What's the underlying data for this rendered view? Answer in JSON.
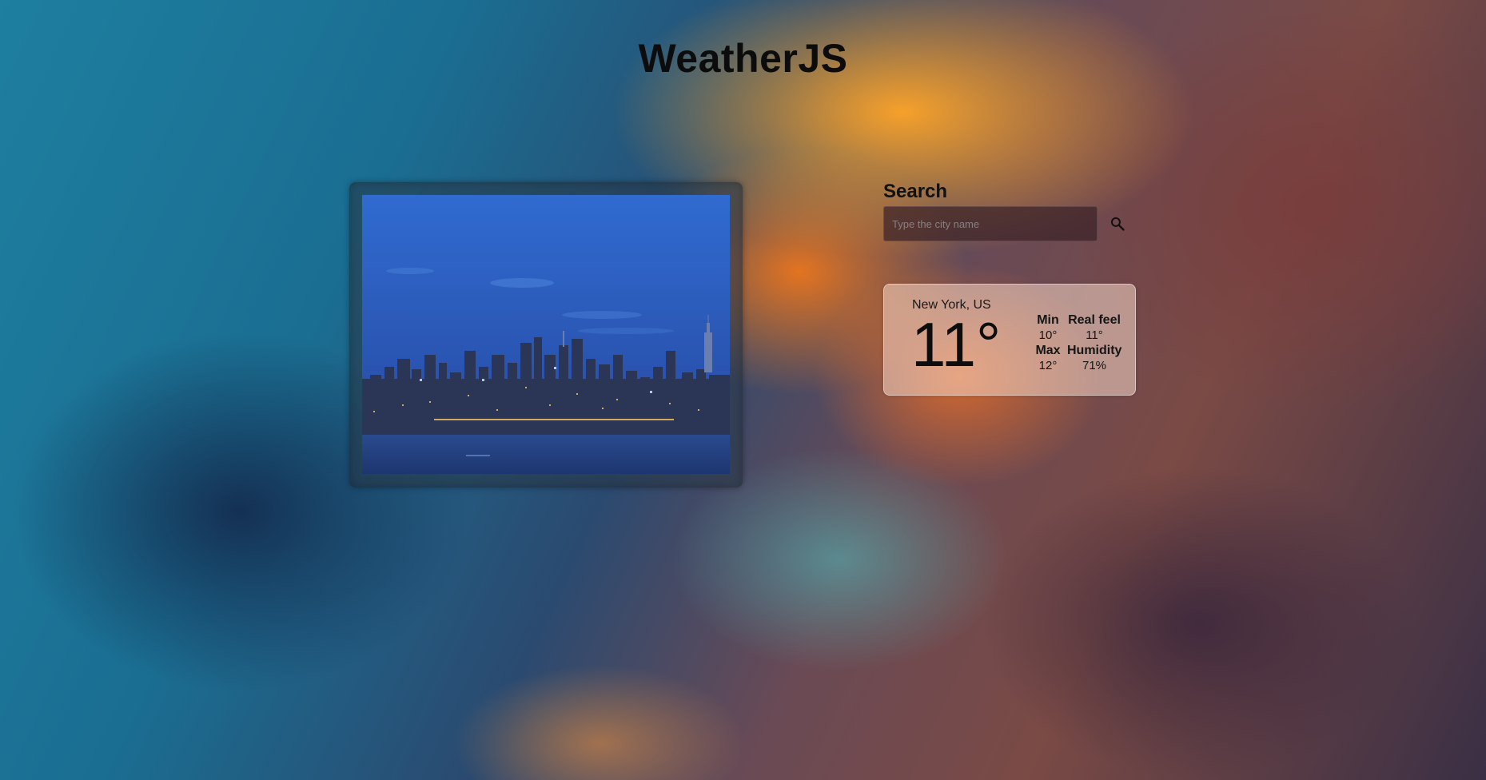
{
  "app": {
    "title": "WeatherJS"
  },
  "search": {
    "heading": "Search",
    "placeholder": "Type the city name",
    "value": "",
    "button_icon": "search-icon"
  },
  "weather": {
    "location": "New York, US",
    "temperature": "11°",
    "min_label": "Min",
    "min_value": "10°",
    "real_feel_label": "Real feel",
    "real_feel_value": "11°",
    "max_label": "Max",
    "max_value": "12°",
    "humidity_label": "Humidity",
    "humidity_value": "71%"
  },
  "colors": {
    "title": "#0c0c0c",
    "input_bg": "#3c2328",
    "card_bg": "#f5d7c8"
  }
}
